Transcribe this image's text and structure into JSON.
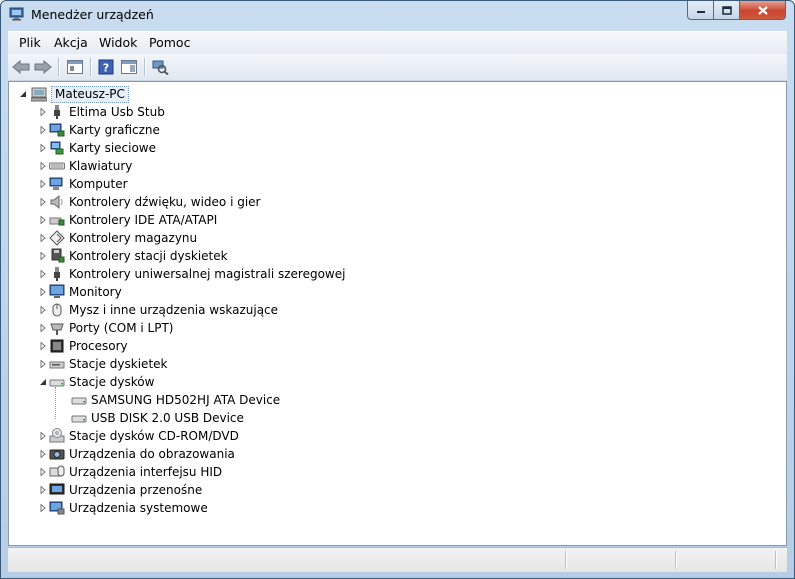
{
  "window": {
    "title": "Menedżer urządzeń"
  },
  "menu": [
    {
      "label": "Plik"
    },
    {
      "label": "Akcja"
    },
    {
      "label": "Widok"
    },
    {
      "label": "Pomoc"
    }
  ],
  "toolbar": {
    "buttons": [
      "back-icon",
      "forward-icon",
      "properties-view-icon",
      "help-icon",
      "console-tree-icon",
      "scan-hardware-icon"
    ]
  },
  "tree": {
    "root": "Mateusz-PC",
    "categories": [
      {
        "label": "Eltima Usb Stub",
        "icon": "usb-plug-icon"
      },
      {
        "label": "Karty graficzne",
        "icon": "display-adapter-icon"
      },
      {
        "label": "Karty sieciowe",
        "icon": "network-adapter-icon"
      },
      {
        "label": "Klawiatury",
        "icon": "keyboard-icon"
      },
      {
        "label": "Komputer",
        "icon": "computer-icon"
      },
      {
        "label": "Kontrolery dźwięku, wideo i gier",
        "icon": "speaker-icon"
      },
      {
        "label": "Kontrolery IDE ATA/ATAPI",
        "icon": "ide-controller-icon"
      },
      {
        "label": "Kontrolery magazynu",
        "icon": "storage-controller-icon"
      },
      {
        "label": "Kontrolery stacji dyskietek",
        "icon": "floppy-controller-icon"
      },
      {
        "label": "Kontrolery uniwersalnej magistrali szeregowej",
        "icon": "usb-controller-icon"
      },
      {
        "label": "Monitory",
        "icon": "monitor-icon"
      },
      {
        "label": "Mysz i inne urządzenia wskazujące",
        "icon": "mouse-icon"
      },
      {
        "label": "Porty (COM i LPT)",
        "icon": "port-icon"
      },
      {
        "label": "Procesory",
        "icon": "processor-icon"
      },
      {
        "label": "Stacje dyskietek",
        "icon": "floppy-drive-icon"
      },
      {
        "label": "Stacje dysków",
        "icon": "disk-drive-icon",
        "expanded": true,
        "children": [
          {
            "label": "SAMSUNG HD502HJ ATA Device",
            "icon": "disk-drive-icon"
          },
          {
            "label": "USB DISK 2.0 USB Device",
            "icon": "disk-drive-icon"
          }
        ]
      },
      {
        "label": "Stacje dysków CD-ROM/DVD",
        "icon": "cdrom-icon"
      },
      {
        "label": "Urządzenia do obrazowania",
        "icon": "camera-icon"
      },
      {
        "label": "Urządzenia interfejsu HID",
        "icon": "hid-icon"
      },
      {
        "label": "Urządzenia przenośne",
        "icon": "portable-device-icon"
      },
      {
        "label": "Urządzenia systemowe",
        "icon": "system-device-icon"
      }
    ]
  }
}
